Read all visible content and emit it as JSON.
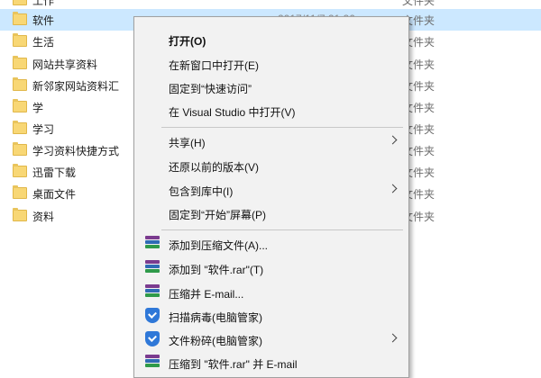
{
  "file_list": {
    "rows": [
      {
        "name": "工作",
        "date": "",
        "type": "文件夹",
        "selected": false
      },
      {
        "name": "软件",
        "date": "2017/11/7 21:26",
        "type": "文件夹",
        "selected": true
      },
      {
        "name": "生活",
        "date": "",
        "type": "文件夹",
        "selected": false
      },
      {
        "name": "网站共享资料",
        "date": "",
        "type": "文件夹",
        "selected": false
      },
      {
        "name": "新邻家网站资料汇",
        "date": "",
        "type": "文件夹",
        "selected": false
      },
      {
        "name": "学",
        "date": "",
        "type": "文件夹",
        "selected": false
      },
      {
        "name": "学习",
        "date": "",
        "type": "文件夹",
        "selected": false
      },
      {
        "name": "学习资料快捷方式",
        "date": "",
        "type": "文件夹",
        "selected": false
      },
      {
        "name": "迅雷下载",
        "date": "",
        "type": "文件夹",
        "selected": false
      },
      {
        "name": "桌面文件",
        "date": "",
        "type": "文件夹",
        "selected": false
      },
      {
        "name": "资料",
        "date": "",
        "type": "文件夹",
        "selected": false
      }
    ]
  },
  "context_menu": {
    "items": [
      {
        "label": "打开(O)",
        "bold": true
      },
      {
        "label": "在新窗口中打开(E)"
      },
      {
        "label": "固定到“快速访问”"
      },
      {
        "label": "在 Visual Studio 中打开(V)"
      },
      {
        "label": "共享(H)",
        "submenu": true
      },
      {
        "label": "还原以前的版本(V)"
      },
      {
        "label": "包含到库中(I)",
        "submenu": true
      },
      {
        "label": "固定到“开始”屏幕(P)"
      },
      {
        "label": "添加到压缩文件(A)...",
        "icon": "winrar-icon"
      },
      {
        "label": "添加到 \"软件.rar\"(T)",
        "icon": "winrar-icon"
      },
      {
        "label": "压缩并 E-mail...",
        "icon": "winrar-icon"
      },
      {
        "label": "扫描病毒(电脑管家)",
        "icon": "shield-icon"
      },
      {
        "label": "文件粉碎(电脑管家)",
        "icon": "shield-icon",
        "submenu": true
      },
      {
        "label": "压缩到 \"软件.rar\" 并 E-mail",
        "icon": "winrar-icon"
      }
    ]
  }
}
